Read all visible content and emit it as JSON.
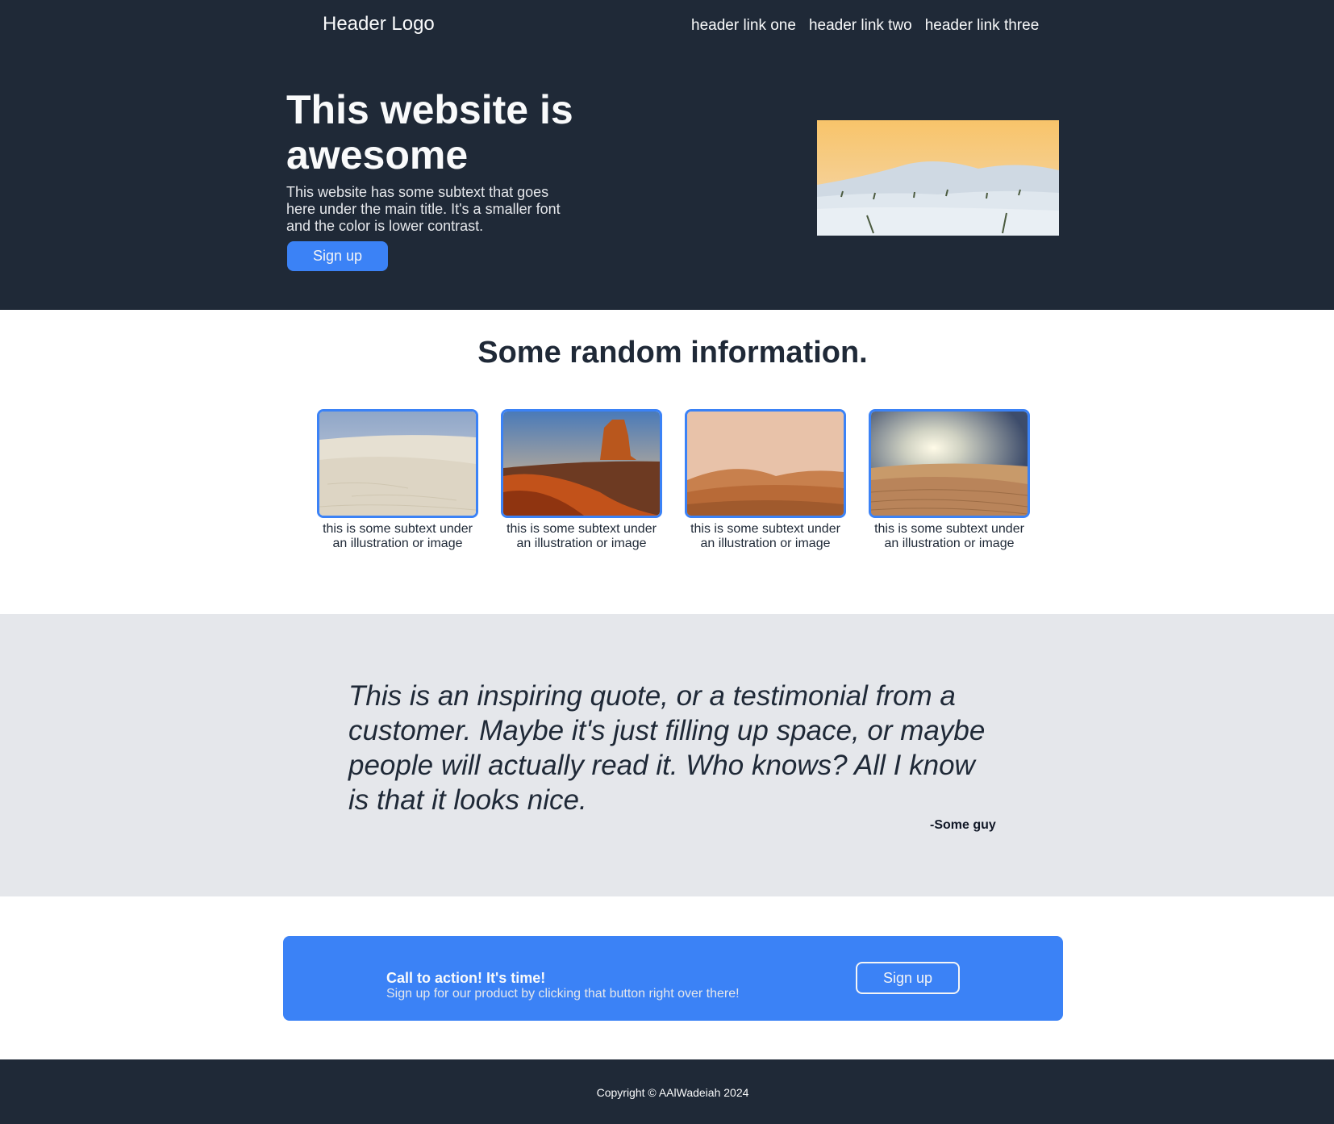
{
  "header": {
    "logo": "Header Logo",
    "links": [
      "header link one",
      "header link two",
      "header link three"
    ]
  },
  "hero": {
    "title": "This website is awesome",
    "subtext": "This website has some subtext that goes here under the main title. It's a smaller font and the color is lower contrast.",
    "button": "Sign up",
    "image": "snowy-dunes-sunset-photo"
  },
  "info": {
    "title": "Some random information.",
    "cards": [
      {
        "image": "white-sand-desert-photo",
        "caption": "this is some subtext under an illustration or image"
      },
      {
        "image": "desert-butte-photo",
        "caption": "this is some subtext under an illustration or image"
      },
      {
        "image": "orange-dunes-photo",
        "caption": "this is some subtext under an illustration or image"
      },
      {
        "image": "sunlit-dunes-photo",
        "caption": "this is some subtext under an illustration or image"
      }
    ]
  },
  "quote": {
    "text": "This is an inspiring quote, or a testimonial from a customer. Maybe it's just filling up space, or maybe people will actually read it. Who knows? All I know is that it looks nice.",
    "author": "-Some guy"
  },
  "cta": {
    "title": "Call to action! It's time!",
    "subtext": "Sign up for our product by clicking that button right over there!",
    "button": "Sign up"
  },
  "footer": {
    "copyright": "Copyright © AAlWadeiah 2024"
  },
  "colors": {
    "dark": "#1f2937",
    "accent": "#3b82f6",
    "quote_bg": "#e5e7eb"
  }
}
